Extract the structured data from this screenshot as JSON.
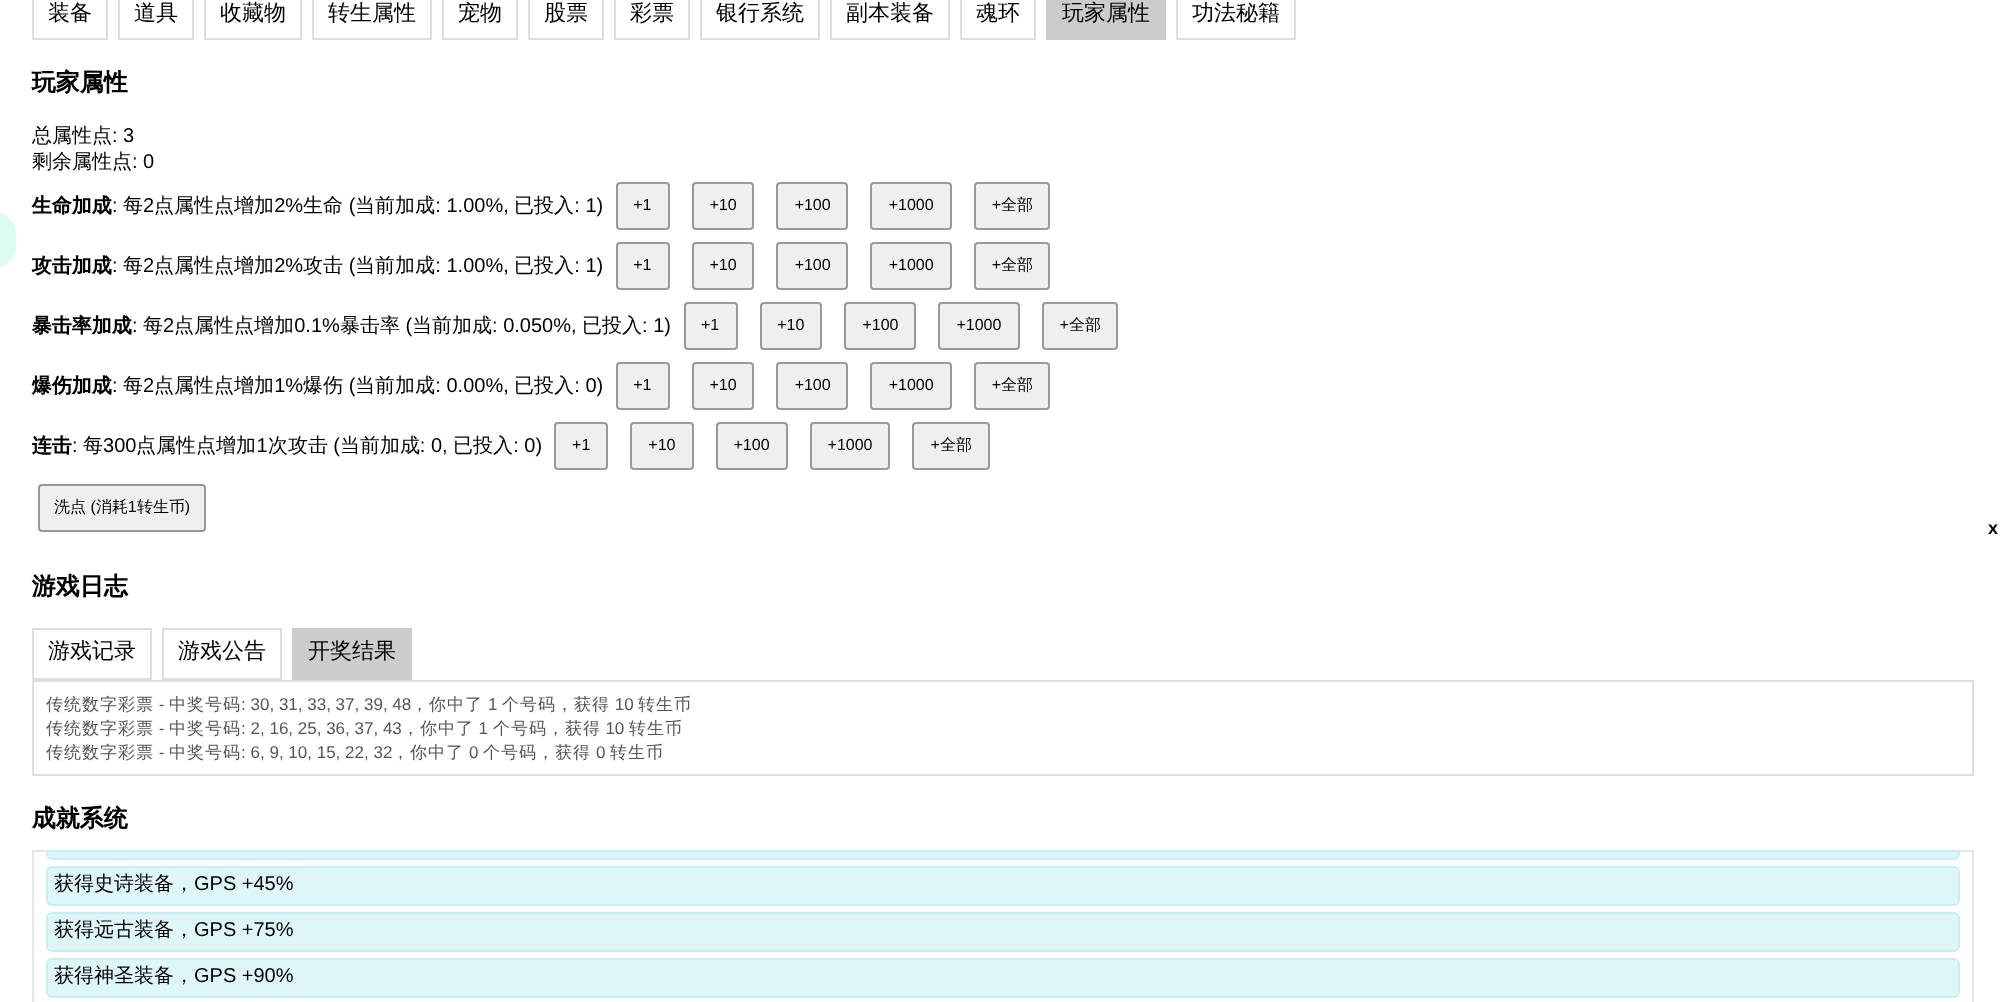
{
  "tabs": [
    {
      "label": "装备",
      "selected": false
    },
    {
      "label": "道具",
      "selected": false
    },
    {
      "label": "收藏物",
      "selected": false
    },
    {
      "label": "转生属性",
      "selected": false
    },
    {
      "label": "宠物",
      "selected": false
    },
    {
      "label": "股票",
      "selected": false
    },
    {
      "label": "彩票",
      "selected": false
    },
    {
      "label": "银行系统",
      "selected": false
    },
    {
      "label": "副本装备",
      "selected": false
    },
    {
      "label": "魂环",
      "selected": false
    },
    {
      "label": "玩家属性",
      "selected": true
    },
    {
      "label": "功法秘籍",
      "selected": false
    }
  ],
  "player_attributes": {
    "title": "玩家属性",
    "total_points": "总属性点: 3",
    "remaining_points": "剩余属性点: 0",
    "stats": [
      {
        "description": "**生命加成**: 每2点属性点增加2%生命 (当前加成: 1.00%, 已投入: 1)",
        "buttons": [
          "+1",
          "+10",
          "+100",
          "+1000",
          "+全部"
        ]
      },
      {
        "description": "**攻击加成**: 每2点属性点增加2%攻击 (当前加成: 1.00%, 已投入: 1)",
        "buttons": [
          "+1",
          "+10",
          "+100",
          "+1000",
          "+全部"
        ]
      },
      {
        "description": "**暴击率加成**: 每2点属性点增加0.1%暴击率 (当前加成: 0.050%, 已投入: 1)",
        "buttons": [
          "+1",
          "+10",
          "+100",
          "+1000",
          "+全部"
        ]
      },
      {
        "description": "**爆伤加成**: 每2点属性点增加1%爆伤 (当前加成: 0.00%, 已投入: 0)",
        "buttons": [
          "+1",
          "+10",
          "+100",
          "+1000",
          "+全部"
        ]
      },
      {
        "description": "**连击**: 每300点属性点增加1次攻击 (当前加成: 0, 已投入: 0)",
        "buttons": [
          "+1",
          "+10",
          "+100",
          "+1000",
          "+全部"
        ]
      }
    ],
    "reset_button": "洗点 (消耗1转生币)"
  },
  "close_mark": "x",
  "game_log": {
    "title": "游戏日志",
    "tabs": [
      {
        "label": "游戏记录",
        "selected": false
      },
      {
        "label": "游戏公告",
        "selected": false
      },
      {
        "label": "开奖结果",
        "selected": true
      }
    ],
    "entries": [
      "传统数字彩票 - 中奖号码: 30, 31, 33, 37, 39, 48，你中了 1 个号码，获得 10 转生币",
      "传统数字彩票 - 中奖号码: 2, 16, 25, 36, 37, 43，你中了 1 个号码，获得 10 转生币",
      "传统数字彩票 - 中奖号码: 6, 9, 10, 15, 22, 32，你中了 0 个号码，获得 0 转生币"
    ]
  },
  "achievements": {
    "title": "成就系统",
    "items": [
      "获得史诗装备，GPS +45%",
      "获得远古装备，GPS +75%",
      "获得神圣装备，GPS +90%"
    ]
  }
}
